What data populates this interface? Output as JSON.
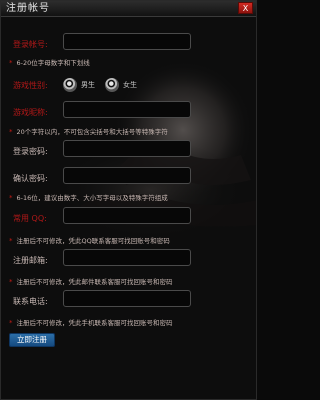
{
  "window": {
    "title": "注册帐号",
    "close_label": "X"
  },
  "form": {
    "account": {
      "label": "登录帐号:",
      "value": "",
      "hint": "6-20位字母数字和下划线"
    },
    "gender": {
      "label": "游戏性别:",
      "options": [
        "男生",
        "女生"
      ],
      "selected": "男生"
    },
    "nickname": {
      "label": "游戏昵称:",
      "value": "",
      "hint": "20个字符以内，不可包含尖括号和大括号等特殊字符"
    },
    "password": {
      "label": "登录密码:",
      "value": ""
    },
    "confirm_password": {
      "label": "确认密码:",
      "value": "",
      "hint": "6-16位，建议由数字、大小写字母以及特殊字符组成"
    },
    "qq": {
      "label": "常用 QQ:",
      "value": "",
      "hint": "注册后不可修改，凭此QQ联系客服可找回账号和密码"
    },
    "email": {
      "label": "注册邮箱:",
      "value": "",
      "hint": "注册后不可修改，凭此邮件联系客服可找回账号和密码"
    },
    "phone": {
      "label": "联系电话:",
      "value": "",
      "hint": "注册后不可修改，凭此手机联系客服可找回账号和密码"
    },
    "submit_label": "立即注册"
  },
  "hint_marker": "*"
}
